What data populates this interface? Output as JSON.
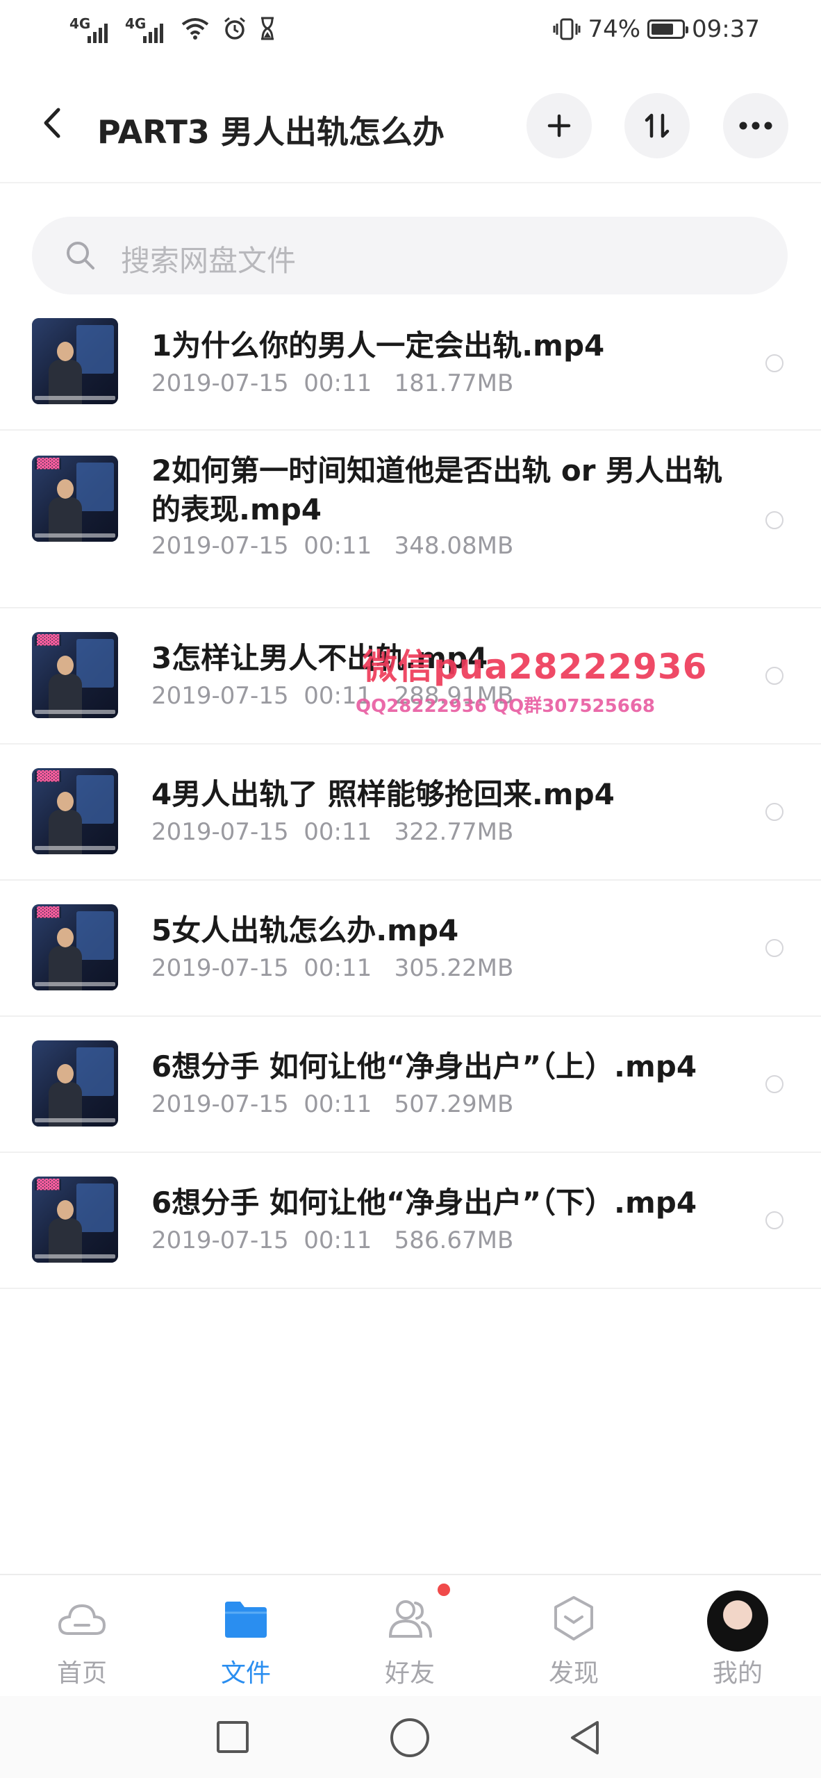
{
  "status_bar": {
    "signal1": "4G",
    "signal2": "4G",
    "battery_percent": "74%",
    "battery_level": 0.74,
    "time": "09:37"
  },
  "header": {
    "title": "PART3 男人出轨怎么办",
    "icons": [
      "back-icon",
      "add-icon",
      "sort-icon",
      "more-icon"
    ]
  },
  "search": {
    "placeholder": "搜索网盘文件"
  },
  "files": [
    {
      "name": "1为什么你的男人一定会出轨.mp4",
      "date": "2019-07-15",
      "time": "00:11",
      "size": "181.77MB"
    },
    {
      "name": "2如何第一时间知道他是否出轨 or 男人出轨的表现.mp4",
      "date": "2019-07-15",
      "time": "00:11",
      "size": "348.08MB"
    },
    {
      "name": "3怎样让男人不出轨.mp4",
      "date": "2019-07-15",
      "time": "00:11",
      "size": "288.91MB"
    },
    {
      "name": "4男人出轨了 照样能够抢回来.mp4",
      "date": "2019-07-15",
      "time": "00:11",
      "size": "322.77MB"
    },
    {
      "name": "5女人出轨怎么办.mp4",
      "date": "2019-07-15",
      "time": "00:11",
      "size": "305.22MB"
    },
    {
      "name": "6想分手 如何让他“净身出户”（上）.mp4",
      "date": "2019-07-15",
      "time": "00:11",
      "size": "507.29MB"
    },
    {
      "name": "6想分手 如何让他“净身出户”（下）.mp4",
      "date": "2019-07-15",
      "time": "00:11",
      "size": "586.67MB"
    }
  ],
  "watermark": {
    "line1": "微信pua28222936",
    "line2": "QQ28222936 QQ群307525668"
  },
  "tabs": [
    {
      "label": "首页",
      "icon": "cloud-icon"
    },
    {
      "label": "文件",
      "icon": "folder-icon"
    },
    {
      "label": "好友",
      "icon": "friends-icon"
    },
    {
      "label": "发现",
      "icon": "discover-icon"
    },
    {
      "label": "我的",
      "icon": "avatar"
    }
  ],
  "colors": {
    "accent": "#2a8ef0",
    "badge": "#f04a4a",
    "watermark": "#ee3b5a"
  }
}
